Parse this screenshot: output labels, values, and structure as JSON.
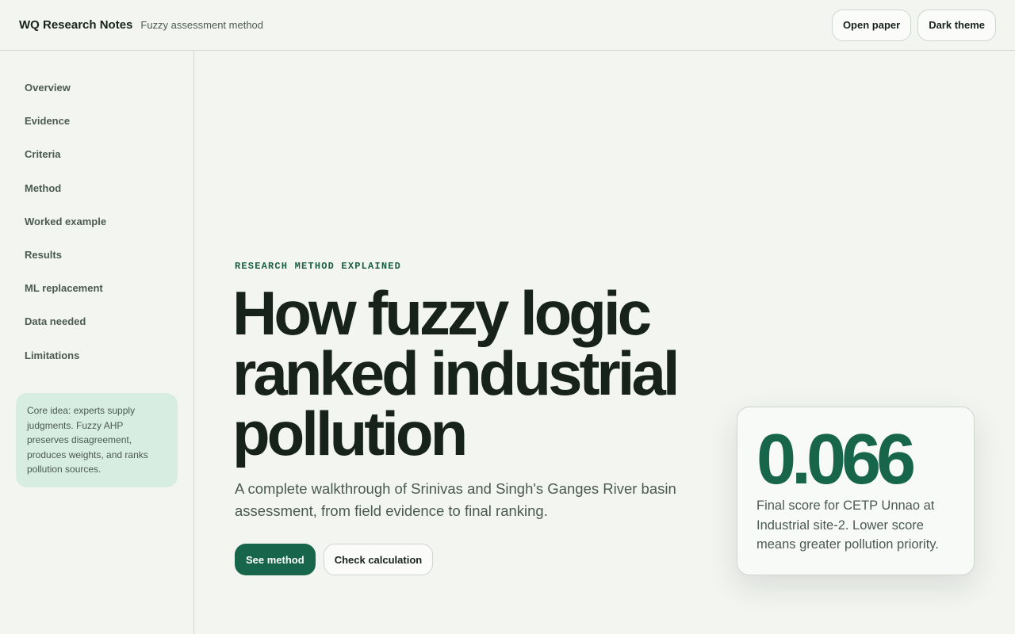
{
  "header": {
    "title": "WQ Research Notes",
    "subtitle": "Fuzzy assessment method",
    "actions": {
      "open_paper": "Open paper",
      "dark_theme": "Dark theme"
    }
  },
  "sidebar": {
    "items": [
      {
        "label": "Overview"
      },
      {
        "label": "Evidence"
      },
      {
        "label": "Criteria"
      },
      {
        "label": "Method"
      },
      {
        "label": "Worked example"
      },
      {
        "label": "Results"
      },
      {
        "label": "ML replacement"
      },
      {
        "label": "Data needed"
      },
      {
        "label": "Limitations"
      }
    ],
    "note": "Core idea: experts supply judgments. Fuzzy AHP preserves disagreement, produces weights, and ranks pollution sources."
  },
  "hero": {
    "kicker": "RESEARCH METHOD EXPLAINED",
    "headline": "How fuzzy logic ranked industrial pollution",
    "lede": "A complete walkthrough of Srinivas and Singh's Ganges River basin assessment, from field evidence to final ranking.",
    "primary_cta": "See method",
    "secondary_cta": "Check calculation"
  },
  "score_card": {
    "value": "0.066",
    "caption": "Final score for CETP Unnao at Industrial site-2. Lower score means greater pollution priority."
  },
  "colors": {
    "accent": "#17654a",
    "background": "#f2f5f0",
    "note_background": "#d8ede2",
    "text": "#17221b"
  }
}
